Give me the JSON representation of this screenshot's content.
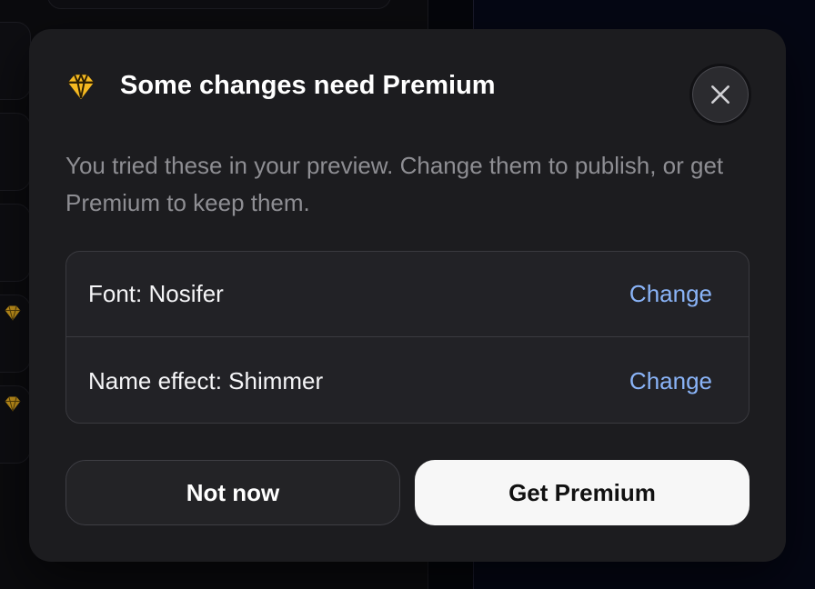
{
  "modal": {
    "title": "Some changes need Premium",
    "description": "You tried these in your preview. Change them to publish, or get Premium to keep them.",
    "changes": [
      {
        "label": "Font: Nosifer",
        "action": "Change"
      },
      {
        "label": "Name effect: Shimmer",
        "action": "Change"
      }
    ],
    "buttons": {
      "secondary": "Not now",
      "primary": "Get Premium"
    },
    "icons": {
      "header": "premium-gem-icon",
      "close": "close-icon"
    },
    "colors": {
      "gem": "#f5b921",
      "link": "#8ab4f8",
      "modal_bg": "#1c1c1f"
    }
  }
}
